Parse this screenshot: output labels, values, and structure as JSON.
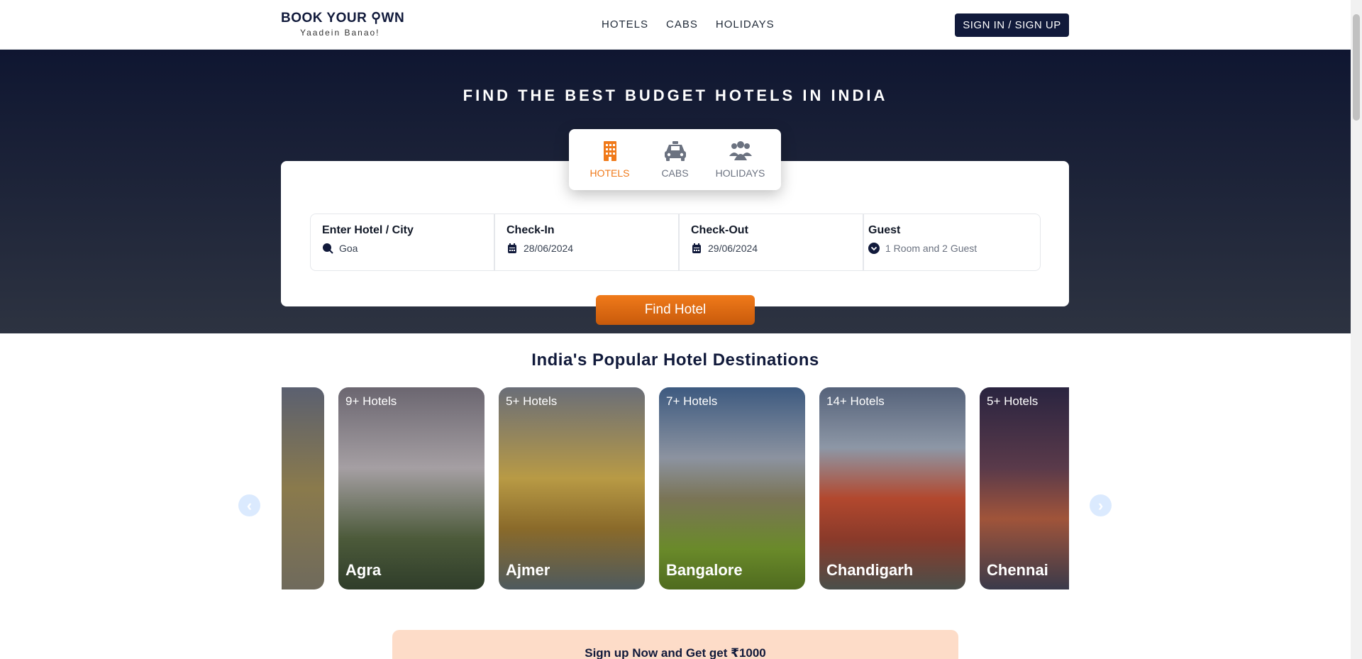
{
  "header": {
    "logo_main": "BOOK YOUR ⚲WN",
    "logo_sub": "Yaadein Banao!",
    "nav": [
      "HOTELS",
      "CABS",
      "HOLIDAYS"
    ],
    "sign_in_label": "SIGN IN / SIGN UP"
  },
  "hero": {
    "title": "FIND THE BEST BUDGET HOTELS IN INDIA",
    "tabs": [
      {
        "label": "HOTELS",
        "icon": "building-icon",
        "active": true
      },
      {
        "label": "CABS",
        "icon": "taxi-icon",
        "active": false
      },
      {
        "label": "HOLIDAYS",
        "icon": "people-icon",
        "active": false
      }
    ],
    "fields": {
      "location": {
        "label": "Enter Hotel / City",
        "value": "Goa"
      },
      "checkin": {
        "label": "Check-In",
        "value": "28/06/2024"
      },
      "checkout": {
        "label": "Check-Out",
        "value": "29/06/2024"
      },
      "guest": {
        "label": "Guest",
        "value": "1 Room and 2 Guest"
      }
    },
    "find_button": "Find Hotel"
  },
  "destinations": {
    "title": "India's Popular Hotel Destinations",
    "cards": [
      {
        "count": "",
        "name": ""
      },
      {
        "count": "9+ Hotels",
        "name": "Agra"
      },
      {
        "count": "5+ Hotels",
        "name": "Ajmer"
      },
      {
        "count": "7+ Hotels",
        "name": "Bangalore"
      },
      {
        "count": "14+ Hotels",
        "name": "Chandigarh"
      },
      {
        "count": "5+ Hotels",
        "name": "Chennai"
      }
    ],
    "prev_arrow": "‹",
    "next_arrow": "›"
  },
  "promo": {
    "text": "Sign up Now and Get get ₹1000"
  },
  "colors": {
    "navy": "#111a3b",
    "accent": "#f07a1a"
  }
}
